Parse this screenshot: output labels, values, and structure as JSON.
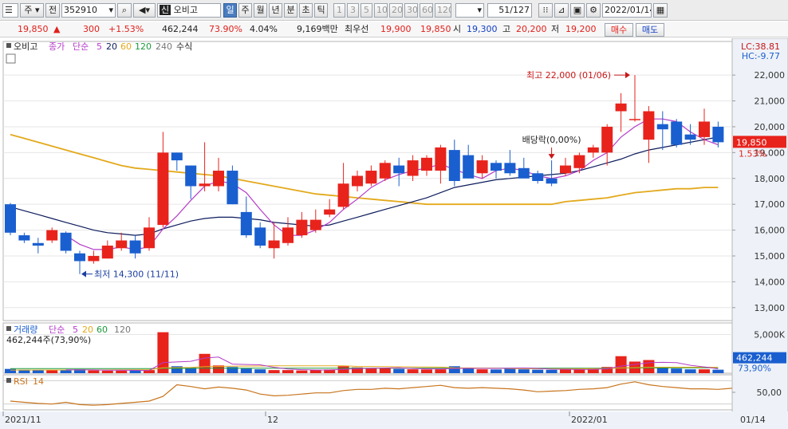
{
  "toolbar": {
    "market": "주",
    "range": "전",
    "code": "352910",
    "name_badge": "신",
    "name": "오비고",
    "periods": [
      "일",
      "주",
      "월",
      "년",
      "분",
      "초",
      "틱"
    ],
    "active_period": "일",
    "minutes": [
      "1",
      "3",
      "5",
      "10",
      "20",
      "30",
      "60",
      "120"
    ],
    "count": "51/127",
    "date": "2022/01/14"
  },
  "quote": {
    "price": "19,850",
    "change": "300",
    "change_pct": "+1.53%",
    "volume": "462,244",
    "vol_ratio": "73.90%",
    "turnover_pct": "4.04%",
    "amount": "9,169백만",
    "priority_label": "최우선",
    "ask": "19,900",
    "bid": "19,850",
    "open_label": "시",
    "open": "19,300",
    "high_label": "고",
    "high": "20,200",
    "low_label": "저",
    "low": "19,200",
    "buy_label": "매수",
    "sell_label": "매도"
  },
  "colors": {
    "up": "#e8231c",
    "down": "#1a5fcf",
    "ma5": "#b43cc8",
    "ma20": "#0d1c5c",
    "ma60": "#e3a91c",
    "rsi": "#c8741c"
  },
  "chart_data": {
    "type": "candlestick",
    "price_legend": {
      "name": "오비고",
      "items": [
        "종가",
        "단순",
        "5",
        "20",
        "60",
        "120",
        "240",
        "수식"
      ]
    },
    "corner": {
      "lc": "LC:38.81",
      "hc": "HC:-9.77"
    },
    "y_ticks": [
      13000,
      14000,
      15000,
      16000,
      17000,
      18000,
      19000,
      20000,
      21000,
      22000
    ],
    "y_tick_labels": [
      "13,000",
      "14,000",
      "15,000",
      "16,000",
      "17,000",
      "18,000",
      "19,000",
      "20,000",
      "21,000",
      "22,000"
    ],
    "ylim": [
      12500,
      23300
    ],
    "last_price": "19,850",
    "last_change": "1.53%",
    "candles": [
      {
        "o": 17000,
        "h": 17050,
        "l": 15800,
        "c": 15900
      },
      {
        "o": 15800,
        "h": 15900,
        "l": 15500,
        "c": 15600
      },
      {
        "o": 15500,
        "h": 15700,
        "l": 15100,
        "c": 15400
      },
      {
        "o": 15600,
        "h": 16100,
        "l": 15500,
        "c": 16000
      },
      {
        "o": 15900,
        "h": 15950,
        "l": 15100,
        "c": 15200
      },
      {
        "o": 15100,
        "h": 15200,
        "l": 14300,
        "c": 14800
      },
      {
        "o": 14800,
        "h": 15200,
        "l": 14700,
        "c": 15000
      },
      {
        "o": 14900,
        "h": 15600,
        "l": 14900,
        "c": 15400
      },
      {
        "o": 15300,
        "h": 15900,
        "l": 15200,
        "c": 15600
      },
      {
        "o": 15600,
        "h": 15800,
        "l": 14900,
        "c": 15100
      },
      {
        "o": 15300,
        "h": 16500,
        "l": 15200,
        "c": 16100
      },
      {
        "o": 16200,
        "h": 19800,
        "l": 16100,
        "c": 19000
      },
      {
        "o": 19000,
        "h": 19000,
        "l": 18300,
        "c": 18700
      },
      {
        "o": 18500,
        "h": 18500,
        "l": 17200,
        "c": 17700
      },
      {
        "o": 17700,
        "h": 19400,
        "l": 17500,
        "c": 17800
      },
      {
        "o": 17700,
        "h": 18800,
        "l": 17500,
        "c": 18300
      },
      {
        "o": 18300,
        "h": 18500,
        "l": 17000,
        "c": 17000
      },
      {
        "o": 16700,
        "h": 17300,
        "l": 15700,
        "c": 15800
      },
      {
        "o": 16100,
        "h": 16300,
        "l": 15300,
        "c": 15400
      },
      {
        "o": 15300,
        "h": 16300,
        "l": 14900,
        "c": 15600
      },
      {
        "o": 15500,
        "h": 16500,
        "l": 15400,
        "c": 16100
      },
      {
        "o": 15800,
        "h": 16700,
        "l": 15700,
        "c": 16400
      },
      {
        "o": 16000,
        "h": 16800,
        "l": 15900,
        "c": 16400
      },
      {
        "o": 16600,
        "h": 17200,
        "l": 16500,
        "c": 16800
      },
      {
        "o": 16900,
        "h": 18600,
        "l": 16800,
        "c": 17800
      },
      {
        "o": 17700,
        "h": 18300,
        "l": 17500,
        "c": 18100
      },
      {
        "o": 17800,
        "h": 18500,
        "l": 17700,
        "c": 18300
      },
      {
        "o": 18000,
        "h": 18700,
        "l": 17900,
        "c": 18600
      },
      {
        "o": 18500,
        "h": 18800,
        "l": 17700,
        "c": 18200
      },
      {
        "o": 18100,
        "h": 18900,
        "l": 17900,
        "c": 18700
      },
      {
        "o": 18300,
        "h": 18900,
        "l": 18100,
        "c": 18800
      },
      {
        "o": 18300,
        "h": 19300,
        "l": 17800,
        "c": 19200
      },
      {
        "o": 19100,
        "h": 19500,
        "l": 17700,
        "c": 17900
      },
      {
        "o": 18900,
        "h": 19300,
        "l": 18200,
        "c": 18000
      },
      {
        "o": 18200,
        "h": 18900,
        "l": 18000,
        "c": 18700
      },
      {
        "o": 18600,
        "h": 18700,
        "l": 18000,
        "c": 18300
      },
      {
        "o": 18600,
        "h": 19100,
        "l": 18100,
        "c": 18200
      },
      {
        "o": 18400,
        "h": 18800,
        "l": 18300,
        "c": 18000
      },
      {
        "o": 18200,
        "h": 18300,
        "l": 17800,
        "c": 17900
      },
      {
        "o": 18000,
        "h": 18700,
        "l": 17700,
        "c": 17800
      },
      {
        "o": 18200,
        "h": 18800,
        "l": 18100,
        "c": 18500
      },
      {
        "o": 18400,
        "h": 19000,
        "l": 18200,
        "c": 18900
      },
      {
        "o": 19000,
        "h": 19300,
        "l": 18800,
        "c": 19200
      },
      {
        "o": 19000,
        "h": 20100,
        "l": 18500,
        "c": 20000
      },
      {
        "o": 20600,
        "h": 21300,
        "l": 19800,
        "c": 20900
      },
      {
        "o": 20300,
        "h": 22000,
        "l": 20200,
        "c": 20300
      },
      {
        "o": 19500,
        "h": 20800,
        "l": 18600,
        "c": 20600
      },
      {
        "o": 20100,
        "h": 20600,
        "l": 19100,
        "c": 19900
      },
      {
        "o": 20200,
        "h": 20300,
        "l": 19200,
        "c": 19300
      },
      {
        "o": 19700,
        "h": 20100,
        "l": 19300,
        "c": 19500
      },
      {
        "o": 19600,
        "h": 20700,
        "l": 19300,
        "c": 20200
      },
      {
        "o": 20000,
        "h": 20200,
        "l": 19200,
        "c": 19400
      }
    ],
    "ma5": [
      null,
      null,
      null,
      null,
      15800,
      15450,
      15250,
      15250,
      15350,
      15250,
      15350,
      16050,
      16550,
      17150,
      17700,
      17900,
      17800,
      17450,
      16800,
      16200,
      15800,
      15800,
      16000,
      16300,
      16800,
      17200,
      17650,
      17950,
      18150,
      18300,
      18400,
      18550,
      18350,
      18150,
      18000,
      18300,
      18400,
      18300,
      18100,
      18000,
      18100,
      18300,
      18700,
      19000,
      19600,
      20000,
      20300,
      20300,
      20200,
      19800,
      19500,
      19300
    ],
    "ma20": [
      16900,
      16750,
      16600,
      16450,
      16300,
      16150,
      16000,
      15900,
      15850,
      15800,
      15850,
      16050,
      16200,
      16350,
      16450,
      16500,
      16500,
      16450,
      16400,
      16300,
      16250,
      16200,
      16150,
      16200,
      16350,
      16500,
      16650,
      16800,
      16950,
      17100,
      17250,
      17450,
      17650,
      17750,
      17850,
      17950,
      18000,
      18050,
      18100,
      18150,
      18200,
      18300,
      18450,
      18600,
      18750,
      18950,
      19100,
      19200,
      19300,
      19400,
      19500,
      19600
    ],
    "ma60": [
      19700,
      19550,
      19400,
      19250,
      19100,
      18950,
      18800,
      18650,
      18500,
      18400,
      18350,
      18300,
      18250,
      18200,
      18150,
      18100,
      18000,
      17900,
      17800,
      17700,
      17600,
      17500,
      17400,
      17350,
      17300,
      17250,
      17200,
      17150,
      17100,
      17050,
      17000,
      17000,
      17000,
      17000,
      17000,
      17000,
      17000,
      17000,
      17000,
      17000,
      17100,
      17150,
      17200,
      17250,
      17350,
      17450,
      17500,
      17550,
      17600,
      17600,
      17650,
      17650
    ],
    "max_annotation": {
      "text": "최고 22,000 (01/06)",
      "index": 45,
      "price": 22000
    },
    "min_annotation": {
      "text": "최저 14,300 (11/11)",
      "index": 5,
      "price": 14300
    },
    "dividend_annotation": {
      "text": "배당락(0,00%)",
      "index": 39
    },
    "volume": {
      "legend": [
        "거래량",
        "단순",
        "5",
        "20",
        "60",
        "120"
      ],
      "current_text": "462,244주(73,90%)",
      "last_value": "462,244",
      "last_pct": "73,90%",
      "y_tick_label": "5,000K",
      "y_tick": 5000000,
      "ylim": [
        0,
        6500000
      ],
      "values": [
        550000,
        450000,
        400000,
        420000,
        380000,
        500000,
        350000,
        320000,
        330000,
        370000,
        400000,
        5300000,
        900000,
        700000,
        2500000,
        1000000,
        800000,
        600000,
        500000,
        400000,
        400000,
        350000,
        420000,
        480000,
        900000,
        750000,
        600000,
        650000,
        550000,
        500000,
        480000,
        500000,
        900000,
        700000,
        500000,
        480000,
        650000,
        500000,
        450000,
        430000,
        480000,
        520000,
        600000,
        800000,
        2200000,
        1500000,
        1700000,
        800000,
        600000,
        500000,
        500000,
        450000
      ],
      "ma5": [
        null,
        null,
        null,
        null,
        440000,
        430000,
        420000,
        390000,
        380000,
        370000,
        350000,
        1360000,
        1450000,
        1540000,
        1960000,
        2080000,
        1180000,
        1120000,
        1080000,
        760000,
        540000,
        450000,
        410000,
        410000,
        510000,
        580000,
        630000,
        670000,
        690000,
        610000,
        556000,
        536000,
        606000,
        626000,
        616000,
        616000,
        646000,
        666000,
        616000,
        512000,
        502000,
        476000,
        496000,
        566000,
        920000,
        1124000,
        1364000,
        1400000,
        1360000,
        1020000,
        820000,
        570000
      ],
      "ma20": [
        400000,
        400000,
        410000,
        410000,
        410000,
        420000,
        420000,
        420000,
        430000,
        430000,
        450000,
        700000,
        720000,
        740000,
        850000,
        880000,
        900000,
        920000,
        930000,
        950000,
        960000,
        960000,
        960000,
        950000,
        950000,
        880000,
        870000,
        860000,
        830000,
        820000,
        800000,
        780000,
        700000,
        680000,
        660000,
        640000,
        600000,
        580000,
        570000,
        560000,
        560000,
        570000,
        580000,
        600000,
        680000,
        720000,
        760000,
        770000,
        770000,
        770000,
        770000,
        760000
      ],
      "ma60": [
        600000,
        600000,
        600000,
        600000,
        600000,
        600000,
        600000,
        600000,
        600000,
        600000,
        600000,
        620000,
        620000,
        630000,
        640000,
        650000,
        650000,
        650000,
        650000,
        650000,
        650000,
        650000,
        650000,
        650000,
        650000,
        650000,
        650000,
        650000,
        650000,
        650000,
        650000,
        650000,
        650000,
        650000,
        650000,
        650000,
        650000,
        650000,
        650000,
        650000,
        650000,
        650000,
        650000,
        650000,
        660000,
        670000,
        680000,
        680000,
        690000,
        690000,
        690000,
        690000
      ]
    },
    "rsi": {
      "legend": [
        "RSI",
        "14"
      ],
      "y_tick_label": "50,00",
      "y_tick": 50,
      "ylim": [
        20,
        80
      ],
      "upper_line": 70,
      "lower_line": 30,
      "values": [
        35,
        33,
        31,
        30,
        33,
        29,
        28,
        29,
        31,
        33,
        35,
        43,
        63,
        60,
        56,
        59,
        57,
        54,
        47,
        44,
        45,
        47,
        49,
        49,
        53,
        55,
        55,
        57,
        56,
        58,
        60,
        62,
        58,
        57,
        58,
        57,
        56,
        54,
        51,
        52,
        53,
        55,
        56,
        58,
        64,
        68,
        63,
        60,
        58,
        56,
        56,
        55,
        57
      ]
    },
    "x_labels": [
      "2021/11",
      "12",
      "2022/01",
      "01/14"
    ]
  }
}
